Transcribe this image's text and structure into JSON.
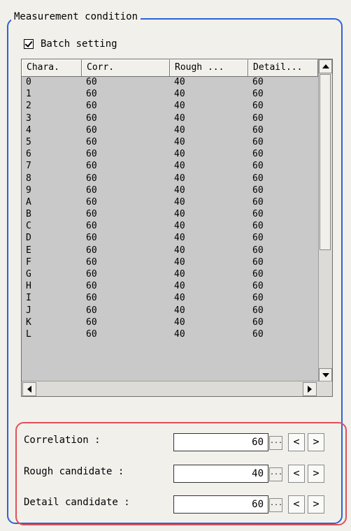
{
  "group": {
    "title": "Measurement condition"
  },
  "batch": {
    "label": "Batch setting",
    "checked": true
  },
  "table": {
    "headers": [
      "Chara.",
      "Corr.",
      "Rough ...",
      "Detail..."
    ],
    "rows": [
      [
        "0",
        "60",
        "40",
        "60"
      ],
      [
        "1",
        "60",
        "40",
        "60"
      ],
      [
        "2",
        "60",
        "40",
        "60"
      ],
      [
        "3",
        "60",
        "40",
        "60"
      ],
      [
        "4",
        "60",
        "40",
        "60"
      ],
      [
        "5",
        "60",
        "40",
        "60"
      ],
      [
        "6",
        "60",
        "40",
        "60"
      ],
      [
        "7",
        "60",
        "40",
        "60"
      ],
      [
        "8",
        "60",
        "40",
        "60"
      ],
      [
        "9",
        "60",
        "40",
        "60"
      ],
      [
        "A",
        "60",
        "40",
        "60"
      ],
      [
        "B",
        "60",
        "40",
        "60"
      ],
      [
        "C",
        "60",
        "40",
        "60"
      ],
      [
        "D",
        "60",
        "40",
        "60"
      ],
      [
        "E",
        "60",
        "40",
        "60"
      ],
      [
        "F",
        "60",
        "40",
        "60"
      ],
      [
        "G",
        "60",
        "40",
        "60"
      ],
      [
        "H",
        "60",
        "40",
        "60"
      ],
      [
        "I",
        "60",
        "40",
        "60"
      ],
      [
        "J",
        "60",
        "40",
        "60"
      ],
      [
        "K",
        "60",
        "40",
        "60"
      ],
      [
        "L",
        "60",
        "40",
        "60"
      ]
    ]
  },
  "fields": [
    {
      "label": "Correlation :",
      "value": "60",
      "ellipsis": "...",
      "prev": "<",
      "next": ">"
    },
    {
      "label": "Rough candidate :",
      "value": "40",
      "ellipsis": "...",
      "prev": "<",
      "next": ">"
    },
    {
      "label": "Detail candidate :",
      "value": "60",
      "ellipsis": "...",
      "prev": "<",
      "next": ">"
    }
  ],
  "colors": {
    "group_border": "#2d63d6",
    "highlight_border": "#e0505a",
    "panel_bg": "#f1f0eb"
  }
}
